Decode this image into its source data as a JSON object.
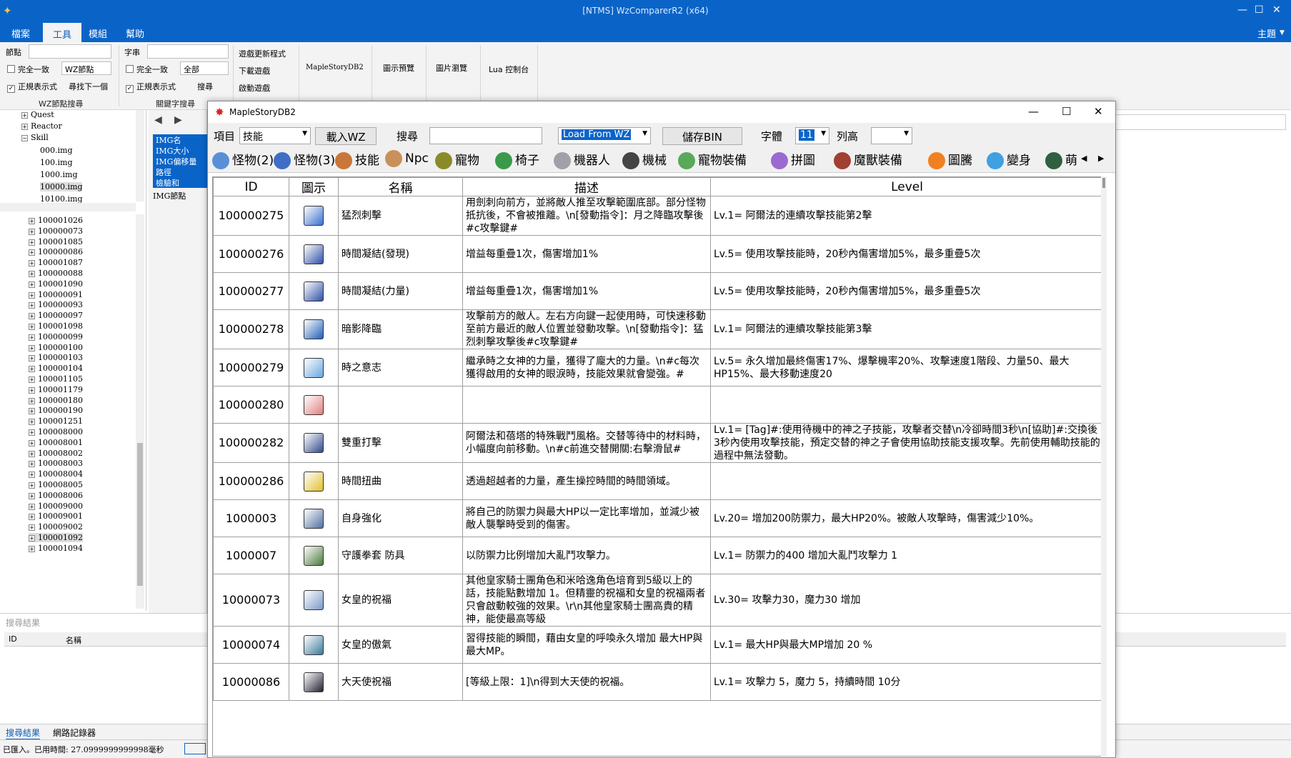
{
  "main": {
    "title": "[NTMS] WzComparerR2 (x64)",
    "menus": [
      "檔案",
      "工具",
      "模組",
      "幫助"
    ],
    "theme": "主題",
    "ribbon": {
      "node_label": "節點",
      "exact1": "完全一致",
      "node_type": "WZ節點",
      "regex1": "正規表示式",
      "find_next": "尋找下一個",
      "group1": "WZ節點搜尋",
      "string_label": "字串",
      "exact2": "完全一致",
      "scope": "全部",
      "regex2": "正規表示式",
      "search": "搜尋",
      "group2": "關鍵字搜尋",
      "game_update": "遊戲更新程式",
      "download_game": "下載遊戲",
      "launch_game": "啟動遊戲",
      "db2": "MapleStoryDB2",
      "preview": "圖示預覽",
      "img_browse": "圖片瀏覽",
      "lua": "Lua 控制台"
    },
    "top_tree": [
      "Quest",
      "Reactor",
      "Skill",
      "000.img",
      "100.img",
      "1000.img",
      "10000.img",
      "10100.img"
    ],
    "mid_items": [
      "IMG名",
      "IMG大小",
      "IMG偏移量",
      "路徑",
      "檢驗和",
      "IMG節點"
    ],
    "bottom_tree": [
      "100001026",
      "100000073",
      "100001085",
      "100000086",
      "100001087",
      "100000088",
      "100001090",
      "100000091",
      "100000093",
      "100000097",
      "100001098",
      "100000099",
      "100000100",
      "100000103",
      "100000104",
      "100001105",
      "100001179",
      "100000180",
      "100000190",
      "100001251",
      "100008000",
      "100008001",
      "100008002",
      "100008003",
      "100008004",
      "100008005",
      "100008006",
      "100009000",
      "100009001",
      "100009002",
      "100001092",
      "100001094"
    ],
    "search_results_title": "搜尋結果",
    "search_cols": [
      "ID",
      "名稱"
    ],
    "bottom_tabs": [
      "搜尋結果",
      "網路記錄器"
    ],
    "status": "已匯入。已用時間: 27.0999999999998毫秒"
  },
  "dialog": {
    "title": "MapleStoryDB2",
    "item_label": "項目",
    "item_value": "技能",
    "load_wz": "載入WZ",
    "search_label": "搜尋",
    "search_value": "",
    "load_from": "Load From WZ",
    "save_bin": "儲存BIN",
    "font_size_label": "字體",
    "font_size": "11",
    "row_height_label": "列高",
    "row_height": "",
    "tabs": [
      {
        "label": "怪物(2)",
        "color": "#5a8fd8"
      },
      {
        "label": "怪物(3)",
        "color": "#3e6fc4"
      },
      {
        "label": "技能",
        "color": "#c8763a"
      },
      {
        "label": "Npc",
        "color": "#c9915a"
      },
      {
        "label": "寵物",
        "color": "#8a8a2a"
      },
      {
        "label": "椅子",
        "color": "#3a9a4a"
      },
      {
        "label": "機器人",
        "color": "#a0a0a8"
      },
      {
        "label": "機械",
        "color": "#444444"
      },
      {
        "label": "寵物裝備",
        "color": "#5aa85a"
      },
      {
        "label": "拼圖",
        "color": "#9b6ad0"
      },
      {
        "label": "魔獸裝備",
        "color": "#a04030"
      },
      {
        "label": "圖騰",
        "color": "#f08020"
      },
      {
        "label": "變身",
        "color": "#40a0e0"
      },
      {
        "label": "萌",
        "color": "#306040"
      }
    ],
    "columns": [
      "ID",
      "圖示",
      "名稱",
      "描述",
      "Level"
    ],
    "rows": [
      {
        "id": "100000275",
        "name": "猛烈刺擊",
        "desc": "用劍刺向前方，並將敵人推至攻擊範圍底部。部分怪物抵抗後，不會被推離。\\n[發動指令]：月之降臨攻擊後#c攻擊鍵#",
        "level": "Lv.1= 阿爾法的連續攻擊技能第2擊",
        "color": "#3a6fd0"
      },
      {
        "id": "100000276",
        "name": "時間凝結(發現)",
        "desc": "增益每重疊1次，傷害增加1%",
        "level": "Lv.5= 使用攻擊技能時，20秒內傷害增加5%，最多重疊5次",
        "color": "#2f4fa8"
      },
      {
        "id": "100000277",
        "name": "時間凝結(力量)",
        "desc": "增益每重疊1次，傷害增加1%",
        "level": "Lv.5= 使用攻擊技能時，20秒內傷害增加5%，最多重疊5次",
        "color": "#2f4fa8"
      },
      {
        "id": "100000278",
        "name": "暗影降臨",
        "desc": "攻擊前方的敵人。左右方向鍵一起使用時，可快速移動至前方最近的敵人位置並發動攻擊。\\n[發動指令]：猛烈刺擊攻擊後#c攻擊鍵#",
        "level": "Lv.1= 阿爾法的連續攻擊技能第3擊",
        "color": "#1e5fb8"
      },
      {
        "id": "100000279",
        "name": "時之意志",
        "desc": "繼承時之女神的力量，獲得了龐大的力量。\\n#c每次獲得啟用的女神的眼淚時，技能效果就會變強。#",
        "level": "Lv.5= 永久增加最終傷害17%、爆擊機率20%、攻擊速度1階段、力量50、最大HP15%、最大移動速度20",
        "color": "#6aa6e0"
      },
      {
        "id": "100000280",
        "name": "",
        "desc": "",
        "level": "",
        "color": "#e08080"
      },
      {
        "id": "100000282",
        "name": "雙重打擊",
        "desc": "阿爾法和蓓塔的特殊戰鬥風格。交替等待中的材料時，小幅度向前移動。\\n#c前進交替開關:右擊滑鼠#",
        "level": "Lv.1= [Tag]#:使用待機中的神之子技能，攻擊者交替\\n冷卻時間3秒\\n[協助]#:交換後3秒內使用攻擊技能，預定交替的神之子會使用協助技能支援攻擊。先前使用輔助技能的過程中無法發動。",
        "color": "#304a8a"
      },
      {
        "id": "100000286",
        "name": "時間扭曲",
        "desc": "透過超越者的力量，產生操控時間的時間領域。",
        "level": "",
        "color": "#e0c030"
      },
      {
        "id": "1000003",
        "name": "自身強化",
        "desc": "將自己的防禦力與最大HP以一定比率增加，並減少被敵人襲擊時受到的傷害。",
        "level": "Lv.20= 增加200防禦力，最大HP20%。被敵人攻擊時，傷害減少10%。",
        "color": "#5070a0"
      },
      {
        "id": "1000007",
        "name": "守護拳套 防具",
        "desc": "以防禦力比例增加大亂鬥攻擊力。",
        "level": "Lv.1= 防禦力的400 增加大亂鬥攻擊力 1",
        "color": "#4a7a3a"
      },
      {
        "id": "10000073",
        "name": "女皇的祝福",
        "desc": "其他皇家騎士團角色和米哈逸角色培育到5級以上的話，技能點數增加 1。但精靈的祝福和女皇的祝福兩者只會啟動較強的效果。\\r\\n其他皇家騎士團高貴的精神，能使最高等級",
        "level": "Lv.30= 攻擊力30，魔力30 增加",
        "color": "#7a9ac8"
      },
      {
        "id": "10000074",
        "name": "女皇的傲氣",
        "desc": "習得技能的瞬間，藉由女皇的呼喚永久增加 最大HP與最大MP。",
        "level": "Lv.1= 最大HP與最大MP增加 20 %",
        "color": "#3a7a9a"
      },
      {
        "id": "10000086",
        "name": "大天使祝福",
        "desc": "[等級上限：1]\\n得到大天使的祝福。",
        "level": "Lv.1= 攻擊力 5，魔力 5，持續時間 10分",
        "color": "#222233"
      }
    ]
  }
}
